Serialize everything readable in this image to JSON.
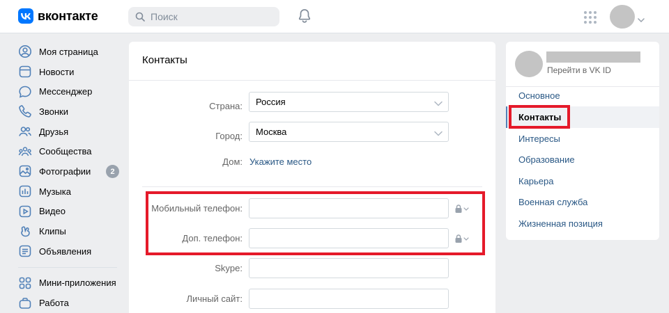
{
  "header": {
    "logo_text": "вконтакте",
    "search_placeholder": "Поиск"
  },
  "leftnav": {
    "items": [
      {
        "label": "Моя страница",
        "icon": "user-circle-icon"
      },
      {
        "label": "Новости",
        "icon": "news-icon"
      },
      {
        "label": "Мессенджер",
        "icon": "chat-icon"
      },
      {
        "label": "Звонки",
        "icon": "phone-icon"
      },
      {
        "label": "Друзья",
        "icon": "friends-icon"
      },
      {
        "label": "Сообщества",
        "icon": "communities-icon"
      },
      {
        "label": "Фотографии",
        "icon": "photo-icon",
        "badge": "2"
      },
      {
        "label": "Музыка",
        "icon": "music-icon"
      },
      {
        "label": "Видео",
        "icon": "video-icon"
      },
      {
        "label": "Клипы",
        "icon": "clips-icon"
      },
      {
        "label": "Объявления",
        "icon": "ads-icon"
      }
    ],
    "items2": [
      {
        "label": "Мини-приложения",
        "icon": "apps-grid-icon"
      },
      {
        "label": "Работа",
        "icon": "briefcase-icon"
      }
    ]
  },
  "main": {
    "title": "Контакты",
    "country_label": "Страна:",
    "country_value": "Россия",
    "city_label": "Город:",
    "city_value": "Москва",
    "home_label": "Дом:",
    "home_link": "Укажите место",
    "mobile_label": "Мобильный телефон:",
    "mobile_value": "",
    "extra_phone_label": "Доп. телефон:",
    "extra_phone_value": "",
    "skype_label": "Skype:",
    "skype_value": "",
    "site_label": "Личный сайт:",
    "site_value": ""
  },
  "right": {
    "vkid_link": "Перейти в VK ID",
    "items": [
      "Основное",
      "Контакты",
      "Интересы",
      "Образование",
      "Карьера",
      "Военная служба",
      "Жизненная позиция"
    ],
    "active_index": 1
  },
  "colors": {
    "accent": "#0077ff",
    "link": "#2a5885",
    "highlight_box": "#e51a2a",
    "badge": "#99a2ad"
  }
}
